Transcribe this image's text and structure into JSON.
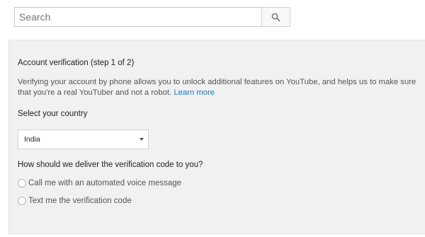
{
  "search": {
    "placeholder": "Search",
    "button_icon": "search-icon"
  },
  "verification": {
    "title": "Account verification (step 1 of 2)",
    "description": "Verifying your account by phone allows you to unlock additional features on YouTube, and helps us to make sure that you're a real YouTuber and not a robot.",
    "learn_more": "Learn more",
    "country_label": "Select your country",
    "country_value": "India",
    "delivery_label": "How should we deliver the verification code to you?",
    "options": [
      {
        "label": "Call me with an automated voice message",
        "selected": false
      },
      {
        "label": "Text me the verification code",
        "selected": false
      }
    ]
  },
  "colors": {
    "panel_background": "#f1f1f1",
    "link": "#167ac6"
  }
}
